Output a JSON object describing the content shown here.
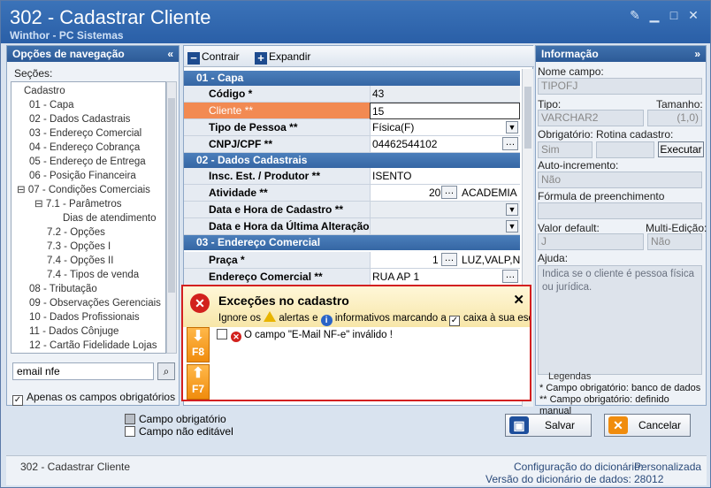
{
  "window": {
    "title": "302 - Cadastrar Cliente",
    "subtitle": "Winthor - PC Sistemas"
  },
  "nav": {
    "header": "Opções de navegação",
    "sections_label": "Seções:",
    "items": [
      "Cadastro",
      "01 - Capa",
      "02 - Dados Cadastrais",
      "03 - Endereço Comercial",
      "04 - Endereço Cobrança",
      "05 - Endereço de Entrega",
      "06 - Posição Financeira",
      "07 - Condições Comerciais",
      "7.1 - Parâmetros",
      "Dias de atendimento",
      "7.2 - Opções",
      "7.3 - Opções I",
      "7.4 - Opções II",
      "7.4 - Tipos de venda",
      "08 - Tributação",
      "09 - Observações Gerenciais",
      "10 - Dados Profissionais",
      "11 - Dados Cônjuge",
      "12 - Cartão Fidelidade Lojas"
    ],
    "search_value": "email nfe",
    "required_only_label": "Apenas os campos obrigatórios"
  },
  "toolbar": {
    "collapse_label": "Contrair",
    "expand_label": "Expandir"
  },
  "grid": {
    "sec1": "01 - Capa",
    "codigo_label": "Código *",
    "codigo_value": "43",
    "cliente_label": "Cliente **",
    "cliente_value": "15",
    "tipo_label": "Tipo de Pessoa **",
    "tipo_value": "Física(F)",
    "cnpj_label": "CNPJ/CPF **",
    "cnpj_value": "04462544102",
    "sec2": "02 - Dados Cadastrais",
    "insc_label": "Insc. Est. / Produtor **",
    "insc_value": "ISENTO",
    "ativ_label": "Atividade **",
    "ativ_code": "20",
    "ativ_name": "ACADEMIA",
    "dtcad_label": "Data e Hora de Cadastro **",
    "dtalt_label": "Data e Hora da Última Alteração",
    "sec3": "03 - Endereço Comercial",
    "praca_label": "Praça *",
    "praca_code": "1",
    "praca_name": "LUZ,VALP,N C",
    "endcom_label": "Endereço Comercial **",
    "endcom_value": "RUA AP 1"
  },
  "info": {
    "header": "Informação",
    "nome_campo_label": "Nome campo:",
    "nome_campo": "TIPOFJ",
    "tipo_label": "Tipo:",
    "tamanho_label": "Tamanho:",
    "tipo": "VARCHAR2",
    "tamanho": "(1,0)",
    "obrig_label": "Obrigatório:",
    "rotina_label": "Rotina cadastro:",
    "obrig": "Sim",
    "executar": "Executar",
    "autoinc_label": "Auto-incremento:",
    "autoinc": "Não",
    "formula_label": "Fórmula de preenchimento",
    "default_label": "Valor default:",
    "multi_label": "Multi-Edição:",
    "default": "J",
    "multi": "Não",
    "ajuda_label": "Ajuda:",
    "ajuda": "Indica se o cliente é pessoa física ou jurídica.",
    "legendas": "Legendas",
    "leg1": "* Campo obrigatório: banco de dados",
    "leg2": "** Campo obrigatório: definido manual"
  },
  "dialog": {
    "title": "Exceções no cadastro",
    "desc_1": "Ignore os",
    "desc_2": "alertas e",
    "desc_3": "informativos marcando a",
    "desc_4": "caixa à sua esque",
    "f8": "F8",
    "f7": "F7",
    "item": "O campo \"E-Mail NF-e\" inválido !"
  },
  "legend_boxes": {
    "obrig": "Campo obrigatório",
    "nao_edit": "Campo não editável"
  },
  "buttons": {
    "salvar": "Salvar",
    "cancelar": "Cancelar"
  },
  "status": {
    "left": "302 - Cadastrar Cliente",
    "config_label": "Configuração do dicionário:",
    "config_value": "Personalizada",
    "versao_label": "Versão do dicionário de dados:",
    "versao_value": "28012"
  },
  "colors": {
    "accent": "#2a5fa7",
    "selected_row": "#f28a52",
    "error": "#d2211d"
  }
}
